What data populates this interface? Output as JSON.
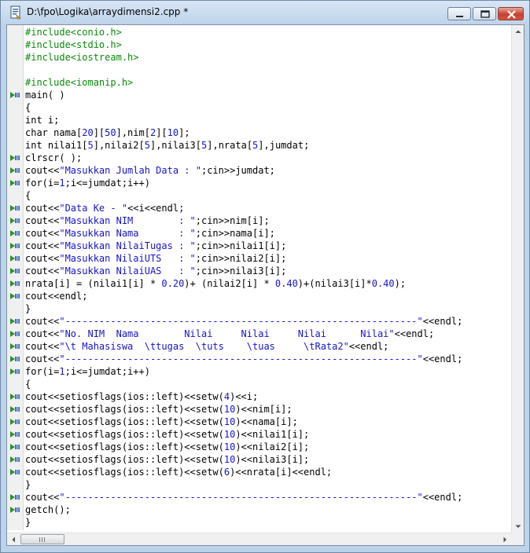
{
  "window": {
    "title": "D:\\fpo\\Logika\\arraydimensi2.cpp *",
    "controls": [
      "minimize",
      "maximize",
      "close"
    ]
  },
  "editor": {
    "lines": [
      {
        "segs": [
          [
            "inc",
            "#include<conio.h>"
          ]
        ],
        "marker": false
      },
      {
        "segs": [
          [
            "inc",
            "#include<stdio.h>"
          ]
        ],
        "marker": false
      },
      {
        "segs": [
          [
            "inc",
            "#include<iostream.h>"
          ]
        ],
        "marker": false
      },
      {
        "segs": [],
        "marker": false
      },
      {
        "segs": [
          [
            "inc",
            "#include<iomanip.h>"
          ]
        ],
        "marker": false
      },
      {
        "segs": [
          [
            "",
            "main( )"
          ]
        ],
        "marker": true
      },
      {
        "segs": [
          [
            "",
            "{"
          ]
        ],
        "marker": false
      },
      {
        "segs": [
          [
            "",
            "int i;"
          ]
        ],
        "marker": false
      },
      {
        "segs": [
          [
            "",
            "char nama["
          ],
          [
            "num",
            "20"
          ],
          [
            "",
            "]["
          ],
          [
            "num",
            "50"
          ],
          [
            "",
            "],nim["
          ],
          [
            "num",
            "2"
          ],
          [
            "",
            "]["
          ],
          [
            "num",
            "10"
          ],
          [
            "",
            "];"
          ]
        ],
        "marker": false
      },
      {
        "segs": [
          [
            "",
            "int nilai1["
          ],
          [
            "num",
            "5"
          ],
          [
            "",
            "],nilai2["
          ],
          [
            "num",
            "5"
          ],
          [
            "",
            "],nilai3["
          ],
          [
            "num",
            "5"
          ],
          [
            "",
            "],nrata["
          ],
          [
            "num",
            "5"
          ],
          [
            "",
            "],jumdat;"
          ]
        ],
        "marker": false
      },
      {
        "segs": [
          [
            "",
            "clrscr( );"
          ]
        ],
        "marker": true
      },
      {
        "segs": [
          [
            "",
            "cout<<"
          ],
          [
            "str",
            "\"Masukkan Jumlah Data : \""
          ],
          [
            "",
            ";cin>>jumdat;"
          ]
        ],
        "marker": true
      },
      {
        "segs": [
          [
            "",
            "for(i="
          ],
          [
            "num",
            "1"
          ],
          [
            "",
            ";i<=jumdat;i++)"
          ]
        ],
        "marker": true
      },
      {
        "segs": [
          [
            "",
            "{"
          ]
        ],
        "marker": false
      },
      {
        "segs": [
          [
            "",
            "cout<<"
          ],
          [
            "str",
            "\"Data Ke - \""
          ],
          [
            "",
            "<<i<<endl;"
          ]
        ],
        "marker": true
      },
      {
        "segs": [
          [
            "",
            "cout<<"
          ],
          [
            "str",
            "\"Masukkan NIM        : \""
          ],
          [
            "",
            ";cin>>nim[i];"
          ]
        ],
        "marker": true
      },
      {
        "segs": [
          [
            "",
            "cout<<"
          ],
          [
            "str",
            "\"Masukkan Nama       : \""
          ],
          [
            "",
            ";cin>>nama[i];"
          ]
        ],
        "marker": true
      },
      {
        "segs": [
          [
            "",
            "cout<<"
          ],
          [
            "str",
            "\"Masukkan NilaiTugas : \""
          ],
          [
            "",
            ";cin>>nilai1[i];"
          ]
        ],
        "marker": true
      },
      {
        "segs": [
          [
            "",
            "cout<<"
          ],
          [
            "str",
            "\"Masukkan NilaiUTS   : \""
          ],
          [
            "",
            ";cin>>nilai2[i];"
          ]
        ],
        "marker": true
      },
      {
        "segs": [
          [
            "",
            "cout<<"
          ],
          [
            "str",
            "\"Masukkan NilaiUAS   : \""
          ],
          [
            "",
            ";cin>>nilai3[i];"
          ]
        ],
        "marker": true
      },
      {
        "segs": [
          [
            "",
            "nrata[i] = (nilai1[i] * "
          ],
          [
            "num",
            "0.20"
          ],
          [
            "",
            ")+ (nilai2[i] * "
          ],
          [
            "num",
            "0.40"
          ],
          [
            "",
            ")+(nilai3[i]*"
          ],
          [
            "num",
            "0.40"
          ],
          [
            "",
            ");"
          ]
        ],
        "marker": true
      },
      {
        "segs": [
          [
            "",
            "cout<<endl;"
          ]
        ],
        "marker": true
      },
      {
        "segs": [
          [
            "",
            "}"
          ]
        ],
        "marker": false
      },
      {
        "segs": [
          [
            "",
            "cout<<"
          ],
          [
            "str",
            "\"--------------------------------------------------------------\""
          ],
          [
            "",
            "<<endl;"
          ]
        ],
        "marker": true
      },
      {
        "segs": [
          [
            "",
            "cout<<"
          ],
          [
            "str",
            "\"No. NIM  Nama        Nilai     Nilai     Nilai      Nilai\""
          ],
          [
            "",
            "<<endl;"
          ]
        ],
        "marker": true
      },
      {
        "segs": [
          [
            "",
            "cout<<"
          ],
          [
            "str",
            "\"\\t Mahasiswa  \\ttugas  \\tuts    \\tuas     \\tRata2\""
          ],
          [
            "",
            "<<endl;"
          ]
        ],
        "marker": true
      },
      {
        "segs": [
          [
            "",
            "cout<<"
          ],
          [
            "str",
            "\"--------------------------------------------------------------\""
          ],
          [
            "",
            "<<endl;"
          ]
        ],
        "marker": true
      },
      {
        "segs": [
          [
            "",
            "for(i="
          ],
          [
            "num",
            "1"
          ],
          [
            "",
            ";i<=jumdat;i++)"
          ]
        ],
        "marker": true
      },
      {
        "segs": [
          [
            "",
            "{"
          ]
        ],
        "marker": false
      },
      {
        "segs": [
          [
            "",
            "cout<<setiosflags(ios::left)<<setw("
          ],
          [
            "num",
            "4"
          ],
          [
            "",
            ")<<i;"
          ]
        ],
        "marker": true
      },
      {
        "segs": [
          [
            "",
            "cout<<setiosflags(ios::left)<<setw("
          ],
          [
            "num",
            "10"
          ],
          [
            "",
            ")<<nim[i];"
          ]
        ],
        "marker": true
      },
      {
        "segs": [
          [
            "",
            "cout<<setiosflags(ios::left)<<setw("
          ],
          [
            "num",
            "10"
          ],
          [
            "",
            ")<<nama[i];"
          ]
        ],
        "marker": true
      },
      {
        "segs": [
          [
            "",
            "cout<<setiosflags(ios::left)<<setw("
          ],
          [
            "num",
            "10"
          ],
          [
            "",
            ")<<nilai1[i];"
          ]
        ],
        "marker": true
      },
      {
        "segs": [
          [
            "",
            "cout<<setiosflags(ios::left)<<setw("
          ],
          [
            "num",
            "10"
          ],
          [
            "",
            ")<<nilai2[i];"
          ]
        ],
        "marker": true
      },
      {
        "segs": [
          [
            "",
            "cout<<setiosflags(ios::left)<<setw("
          ],
          [
            "num",
            "10"
          ],
          [
            "",
            ")<<nilai3[i];"
          ]
        ],
        "marker": true
      },
      {
        "segs": [
          [
            "",
            "cout<<setiosflags(ios::left)<<setw("
          ],
          [
            "num",
            "6"
          ],
          [
            "",
            ")<<nrata[i]<<endl;"
          ]
        ],
        "marker": true
      },
      {
        "segs": [
          [
            "",
            "}"
          ]
        ],
        "marker": false
      },
      {
        "segs": [
          [
            "",
            "cout<<"
          ],
          [
            "str",
            "\"--------------------------------------------------------------\""
          ],
          [
            "",
            "<<endl;"
          ]
        ],
        "marker": true
      },
      {
        "segs": [
          [
            "",
            "getch();"
          ]
        ],
        "marker": true
      },
      {
        "segs": [
          [
            "",
            "}"
          ]
        ],
        "marker": false
      }
    ]
  },
  "colors": {
    "preprocessor": "#0a8a0a",
    "string": "#1515cc",
    "number": "#1515cc",
    "text": "#000000",
    "marker_green": "#2f8f2f",
    "marker_blue": "#2f5fbf"
  },
  "icons": [
    "document-icon",
    "step-marker-icon",
    "scroll-up-arrow",
    "scroll-down-arrow",
    "scroll-left-arrow",
    "scroll-right-arrow"
  ]
}
